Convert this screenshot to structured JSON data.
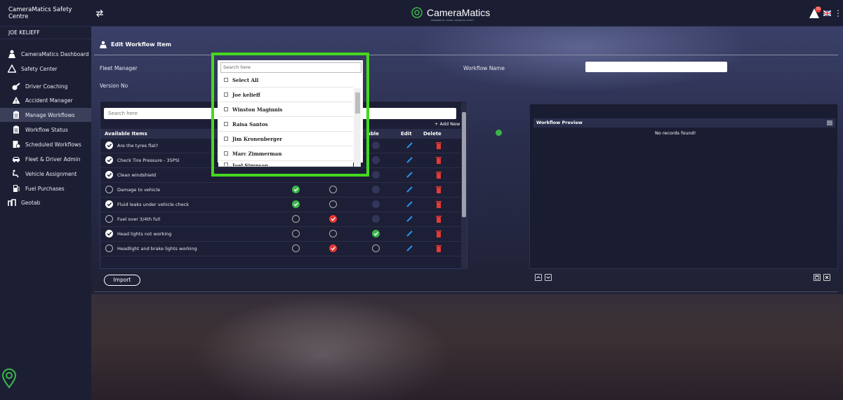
{
  "app": {
    "brand_title": "CameraMatics Safety Centre",
    "logo_text": "CameraMatics",
    "logo_subtext": "POWERED BY VISION. DRIVEN BY SAFETY",
    "notification_count": "10"
  },
  "sidebar": {
    "user": "JOE KELIEFF",
    "items": [
      {
        "label": "CameraMatics Dashboard",
        "icon": "driver-icon"
      },
      {
        "label": "Safety Center",
        "icon": "warning-outline-icon"
      },
      {
        "label": "Driver Coaching",
        "icon": "whistle-icon"
      },
      {
        "label": "Accident Manager",
        "icon": "warning-icon"
      },
      {
        "label": "Manage Workflows",
        "icon": "clipboard-icon"
      },
      {
        "label": "Workflow Status",
        "icon": "clipboard-icon"
      },
      {
        "label": "Scheduled Workflows",
        "icon": "schedule-icon"
      },
      {
        "label": "Fleet & Driver Admin",
        "icon": "car-icon"
      },
      {
        "label": "Vehicle Assignment",
        "icon": "seat-icon"
      },
      {
        "label": "Fuel Purchases",
        "icon": "fuel-icon"
      },
      {
        "label": "Geotab",
        "icon": "geotab-icon"
      }
    ],
    "active_index": 4
  },
  "form": {
    "title": "Edit Workflow Item",
    "fleet_manager_label": "Fleet Manager",
    "version_label": "Version No",
    "workflow_name_label": "Workflow Name",
    "workflow_name_value": ""
  },
  "dropdown": {
    "search_placeholder": "Search here",
    "options": [
      "Select All",
      "Joe kelieff",
      "Winston Maginnis",
      "Raisa Santos",
      "Jim Kronenberger",
      "Marc Zimmerman",
      "Joel Simpson"
    ]
  },
  "items_table": {
    "search_placeholder": "Search here",
    "add_new": "+ Add New",
    "headers": {
      "available": "Available Items",
      "col3": "able",
      "edit": "Edit",
      "delete": "Delete"
    },
    "rows": [
      {
        "name": "Are the tyres flat?",
        "checked": true,
        "c1": "hidden",
        "c2": "hidden",
        "c3": "dark"
      },
      {
        "name": "Check Tire Pressure - 35PSI",
        "checked": true,
        "c1": "hidden",
        "c2": "hidden",
        "c3": "dark"
      },
      {
        "name": "Clean windshield",
        "checked": true,
        "c1": "hidden",
        "c2": "hidden",
        "c3": "dark"
      },
      {
        "name": "Damage to vehicle",
        "checked": false,
        "c1": "green",
        "c2": "empty",
        "c3": "dark"
      },
      {
        "name": "Fluid leaks under vehicle check",
        "checked": true,
        "c1": "green",
        "c2": "empty",
        "c3": "dark"
      },
      {
        "name": "Fuel over 3/4th full",
        "checked": false,
        "c1": "empty",
        "c2": "red",
        "c3": "dark"
      },
      {
        "name": "Head lights not working",
        "checked": true,
        "c1": "empty",
        "c2": "empty",
        "c3": "green"
      },
      {
        "name": "Headlight and brake lights working",
        "checked": false,
        "c1": "empty",
        "c2": "red",
        "c3": "empty"
      }
    ],
    "import_label": "Import"
  },
  "preview": {
    "title": "Workflow Preview",
    "empty_text": "No records found!"
  },
  "colors": {
    "accent_green": "#3ab54a",
    "highlight": "#45d91f",
    "danger": "#e53935",
    "edit_blue": "#2196f3"
  }
}
